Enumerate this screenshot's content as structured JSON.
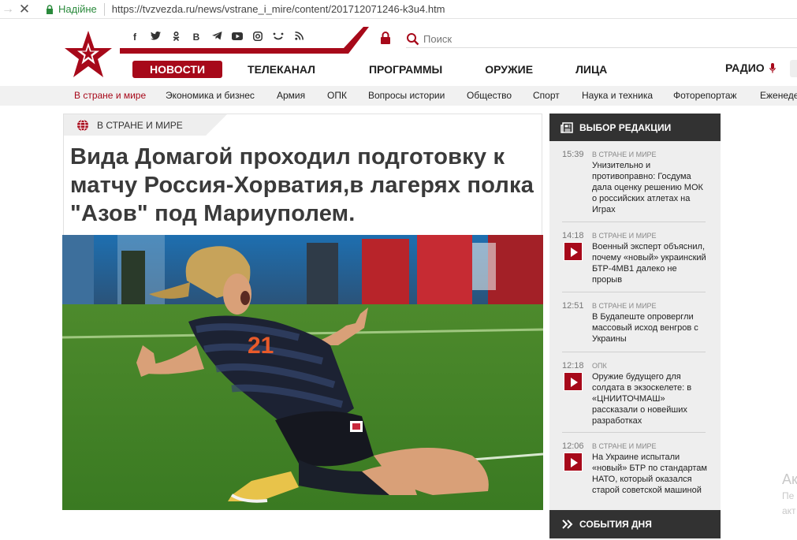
{
  "browser": {
    "secure_label": "Надійне",
    "url": "https://tvzvezda.ru/news/vstrane_i_mire/content/201712071246-k3u4.htm"
  },
  "header": {
    "search_placeholder": "Поиск",
    "social_icons": [
      "facebook-icon",
      "twitter-icon",
      "odnoklassniki-icon",
      "vk-icon",
      "telegram-icon",
      "youtube-icon",
      "instagram-icon",
      "yandex-zen-icon",
      "rss-icon"
    ],
    "social_glyphs": [
      "f",
      "𝕥",
      "ꙩ",
      "B",
      "➤",
      "▶",
      "◎",
      "ᴗ",
      "≋"
    ],
    "nav": [
      {
        "label": "НОВОСТИ",
        "active": true
      },
      {
        "label": "ТЕЛЕКАНАЛ"
      },
      {
        "label": "ПРОГРАММЫ"
      },
      {
        "label": "ОРУЖИЕ"
      },
      {
        "label": "ЛИЦА"
      }
    ],
    "radio_label": "РАДИО"
  },
  "subnav": [
    "В стране и мире",
    "Экономика и бизнес",
    "Армия",
    "ОПК",
    "Вопросы истории",
    "Общество",
    "Спорт",
    "Наука и техника",
    "Фоторепортаж",
    "Еженедельник"
  ],
  "article": {
    "rubric": "В СТРАНЕ И МИРЕ",
    "headline": "Вида Домагой проходил подготовку к матчу Россия-Хорватия,в лагерях полка \"Азов\" под Мариуполем.",
    "photo_number": "21"
  },
  "sidebar": {
    "title": "ВЫБОР РЕДАКЦИИ",
    "items": [
      {
        "time": "15:39",
        "category": "В СТРАНЕ И МИРЕ",
        "title": "Унизительно и противоправно: Госдума дала оценку решению МОК о российских атлетах на Играх",
        "video": false
      },
      {
        "time": "14:18",
        "category": "В СТРАНЕ И МИРЕ",
        "title": "Военный эксперт объяснил, почему «новый» украинский БТР-4МВ1 далеко не прорыв",
        "video": true
      },
      {
        "time": "12:51",
        "category": "В СТРАНЕ И МИРЕ",
        "title": "В Будапеште опровергли массовый исход венгров с Украины",
        "video": false
      },
      {
        "time": "12:18",
        "category": "ОПК",
        "title": "Оружие будущего для солдата в экзоскелете: в «ЦНИИТОЧМАШ» рассказали о новейших разработках",
        "video": true
      },
      {
        "time": "12:06",
        "category": "В СТРАНЕ И МИРЕ",
        "title": "На Украине испытали «новый» БТР по стандартам НАТО, который оказался старой советской машиной",
        "video": true
      }
    ],
    "footer": "СОБЫТИЯ ДНЯ"
  },
  "ghost_text": [
    "Ак",
    "Пе",
    "акт"
  ],
  "colors": {
    "brand_red": "#a7091a",
    "dark": "#323232",
    "secure_green": "#2a8a3c"
  }
}
